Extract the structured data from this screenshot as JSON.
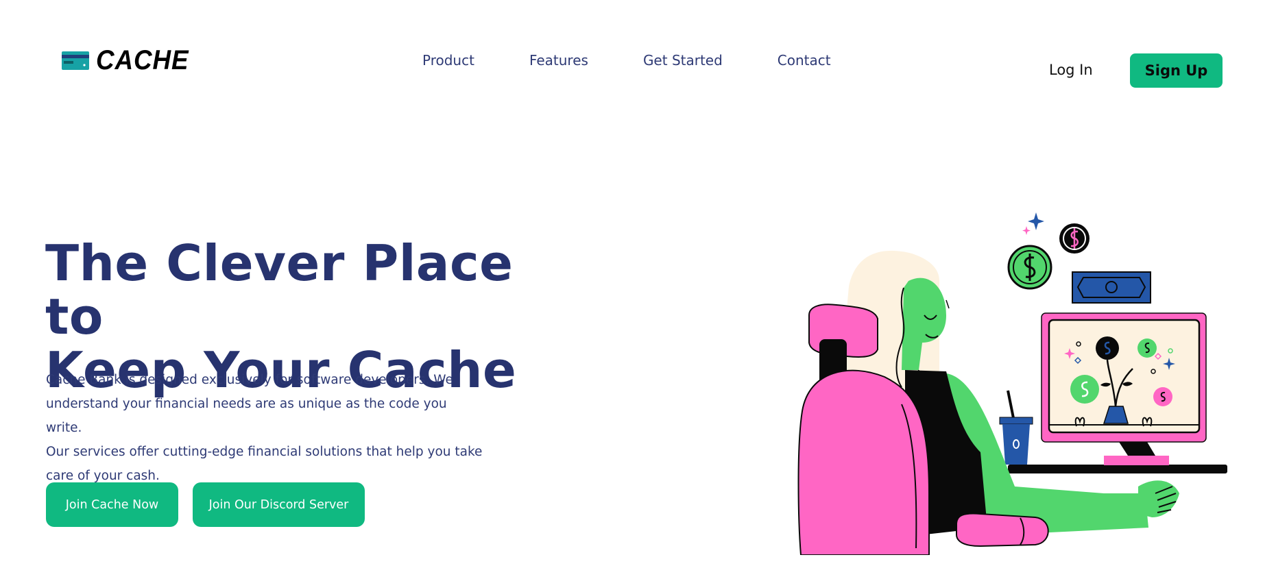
{
  "brand": {
    "name": "CACHE",
    "icon": "credit-card-icon"
  },
  "nav": {
    "items": [
      {
        "label": "Product"
      },
      {
        "label": "Features"
      },
      {
        "label": "Get Started"
      },
      {
        "label": "Contact"
      }
    ]
  },
  "auth": {
    "login_label": "Log In",
    "signup_label": "Sign Up"
  },
  "hero": {
    "title_line1": "The Clever Place to",
    "title_line2": "Keep Your Cache",
    "description_lines": [
      "Cache Bank is designed exclusively for software developers. We",
      "understand your financial needs are as unique as the code you write.",
      "Our services offer cutting-edge financial solutions that help you take",
      "care of your cash."
    ],
    "buttons": [
      {
        "label": "Join Cache Now"
      },
      {
        "label": "Join Our Discord Server"
      }
    ]
  },
  "colors": {
    "accent": "#10b981",
    "heading": "#27336f",
    "nav_text": "#2e3a75",
    "illustration_pink": "#ff66c4",
    "illustration_green": "#52d66d",
    "illustration_blue": "#2457a8",
    "illustration_cream": "#fdf2e0"
  },
  "illustration": {
    "icon": "developer-at-computer-illustration"
  }
}
